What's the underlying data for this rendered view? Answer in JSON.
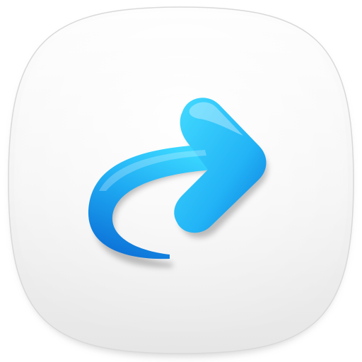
{
  "icon": {
    "name": "redo-arrow-icon",
    "glyph": "curved-forward-arrow",
    "colors": {
      "tile_light": "#fbfbfb",
      "tile_dark": "#ececec",
      "tile_edge": "#d6d6d6",
      "arrow_light": "#33d0ff",
      "arrow_mid": "#1aa6f0",
      "arrow_dark": "#0a6fd8",
      "shadow": "#9a9a9a"
    }
  }
}
